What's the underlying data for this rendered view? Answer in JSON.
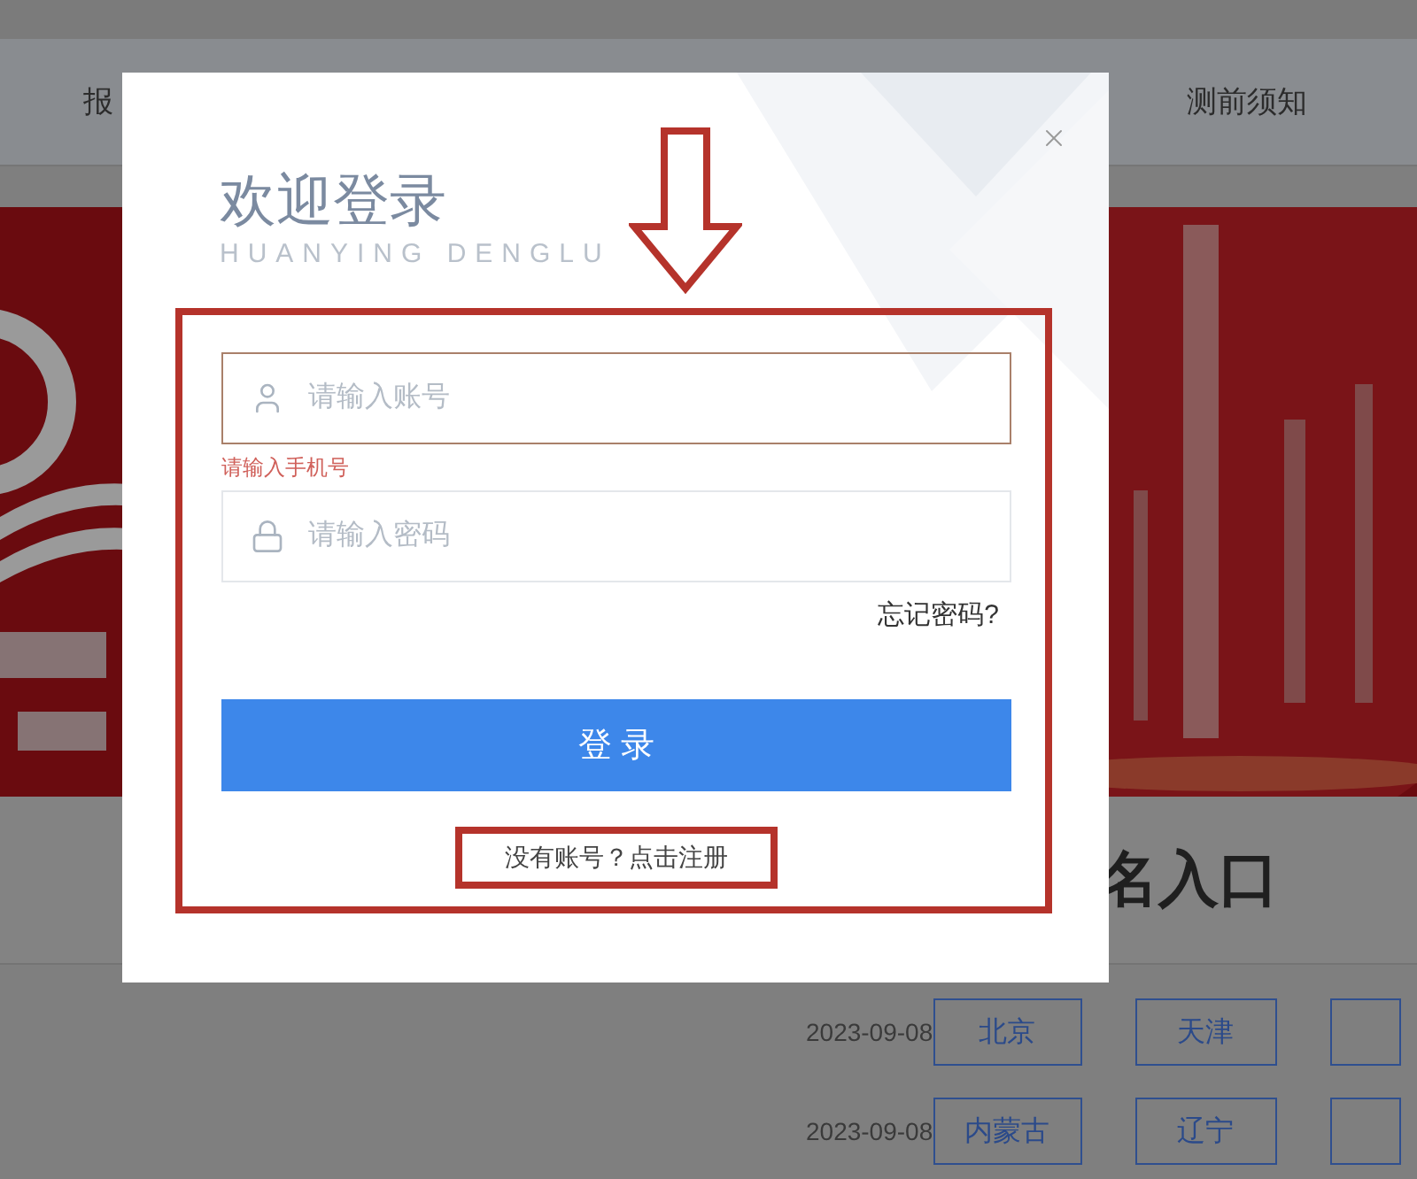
{
  "nav": {
    "items": [
      {
        "label": "报"
      },
      {
        "label": "测前须知"
      }
    ]
  },
  "section": {
    "title": "名入口"
  },
  "rows": [
    {
      "date": "2023-09-08",
      "regions": [
        "北京",
        "天津"
      ]
    },
    {
      "date": "2023-09-08",
      "regions": [
        "内蒙古",
        "辽宁"
      ]
    }
  ],
  "modal": {
    "title": "欢迎登录",
    "subtitle": "HUANYING DENGLU",
    "annotation_arrow": true,
    "form": {
      "highlighted": true,
      "fields": [
        {
          "kind": "account",
          "placeholder": "请输入账号",
          "error": true,
          "error_text": "请输入手机号"
        },
        {
          "kind": "password",
          "placeholder": "请输入密码",
          "error": false
        }
      ],
      "forgot": "忘记密码?",
      "login": "登 录",
      "register": "没有账号？点击注册",
      "register_highlighted": true
    }
  }
}
